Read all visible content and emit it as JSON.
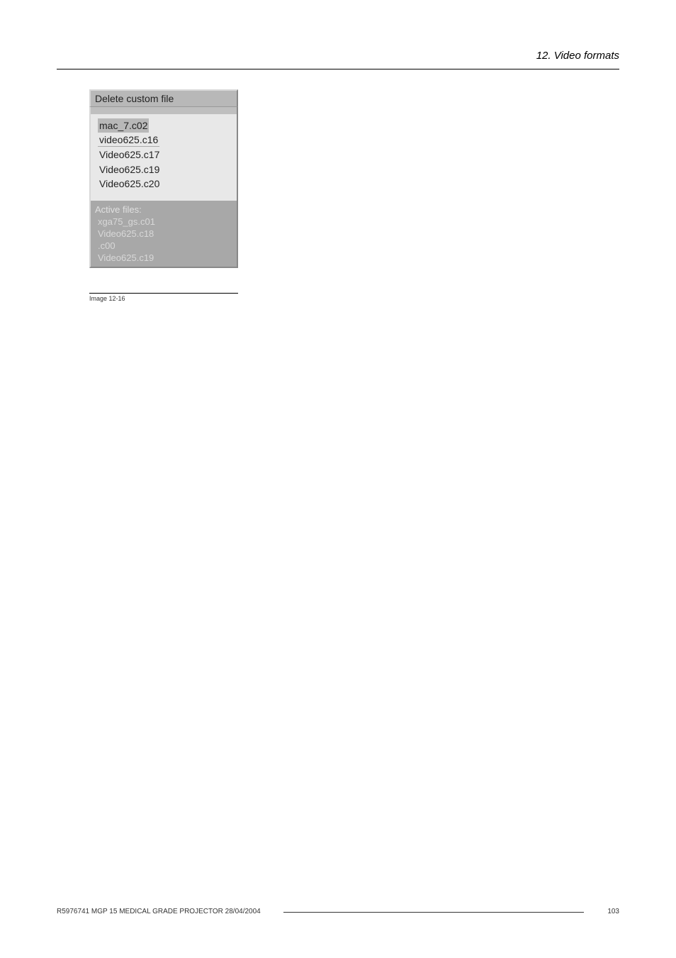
{
  "header": {
    "section": "12.  Video formats"
  },
  "dialog": {
    "title": "Delete custom file",
    "files": [
      "mac_7.c02",
      "video625.c16",
      "Video625.c17",
      "Video625.c19",
      "Video625.c20"
    ],
    "active_label": "Active files:",
    "active_files": [
      "xga75_gs.c01",
      "Video625.c18",
      ".c00",
      "Video625.c19"
    ]
  },
  "caption": "Image 12-16",
  "footer": {
    "left": "R5976741   MGP 15 MEDICAL GRADE PROJECTOR  28/04/2004",
    "page": "103"
  }
}
